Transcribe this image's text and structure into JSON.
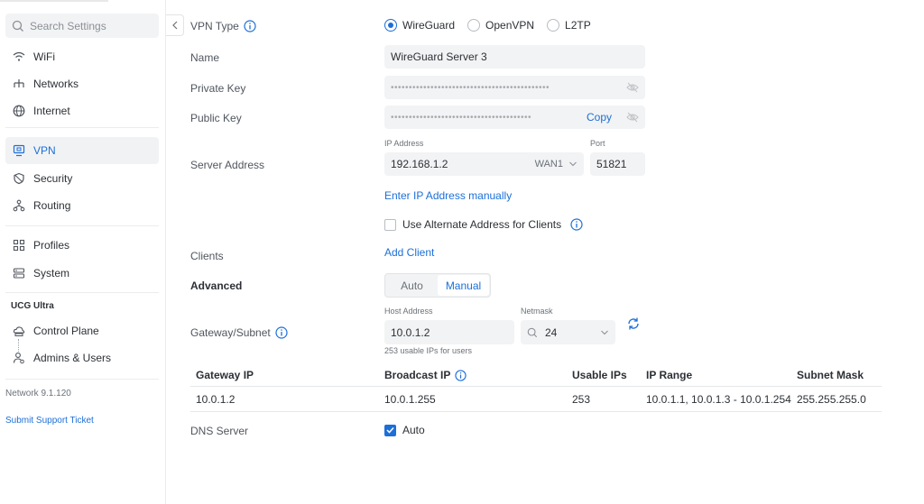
{
  "sidebar": {
    "search_placeholder": "Search Settings",
    "items": [
      {
        "label": "WiFi",
        "icon": "wifi-icon"
      },
      {
        "label": "Networks",
        "icon": "network-tree-icon"
      },
      {
        "label": "Internet",
        "icon": "globe-icon"
      },
      {
        "label": "VPN",
        "icon": "vpn-monitor-icon",
        "active": true
      },
      {
        "label": "Security",
        "icon": "shield-icon"
      },
      {
        "label": "Routing",
        "icon": "routing-icon"
      },
      {
        "label": "Profiles",
        "icon": "profiles-grid-icon"
      },
      {
        "label": "System",
        "icon": "server-icon"
      },
      {
        "label": "Control Plane",
        "icon": "cloud-console-icon"
      },
      {
        "label": "Admins & Users",
        "icon": "user-admin-icon"
      }
    ],
    "section_title": "UCG Ultra",
    "version": "Network 9.1.120",
    "support_link": "Submit Support Ticket"
  },
  "form": {
    "vpn_type_label": "VPN Type",
    "vpn_types": [
      "WireGuard",
      "OpenVPN",
      "L2TP"
    ],
    "vpn_type_selected": "WireGuard",
    "name_label": "Name",
    "name_value": "WireGuard Server 3",
    "private_key_label": "Private Key",
    "private_key_mask": "••••••••••••••••••••••••••••••••••••••••••••",
    "public_key_label": "Public Key",
    "public_key_mask": "•••••••••••••••••••••••••••••••••••••••",
    "copy_label": "Copy",
    "server_address_label": "Server Address",
    "ip_address_label": "IP Address",
    "ip_address_value": "192.168.1.2",
    "wan_value": "WAN1",
    "port_label": "Port",
    "port_value": "51821",
    "enter_ip_link": "Enter IP Address manually",
    "alternate_address_label": "Use Alternate Address for Clients",
    "alternate_address_checked": false,
    "clients_label": "Clients",
    "add_client_link": "Add Client",
    "advanced_label": "Advanced",
    "advanced_modes": [
      "Auto",
      "Manual"
    ],
    "advanced_selected": "Manual",
    "gateway_subnet_label": "Gateway/Subnet",
    "host_address_label": "Host Address",
    "host_address_value": "10.0.1.2",
    "netmask_label": "Netmask",
    "netmask_value": "24",
    "usable_hint": "253 usable IPs for users",
    "dns_label": "DNS Server",
    "dns_auto_label": "Auto",
    "dns_auto_checked": true
  },
  "table": {
    "headers": [
      "Gateway IP",
      "Broadcast IP",
      "Usable IPs",
      "IP Range",
      "Subnet Mask"
    ],
    "row": [
      "10.0.1.2",
      "10.0.1.255",
      "253",
      "10.0.1.1, 10.0.1.3 - 10.0.1.254",
      "255.255.255.0"
    ]
  },
  "colors": {
    "accent": "#1c6fd8",
    "text": "#2c3035",
    "muted": "#50565e",
    "field_bg": "#f2f3f4"
  }
}
